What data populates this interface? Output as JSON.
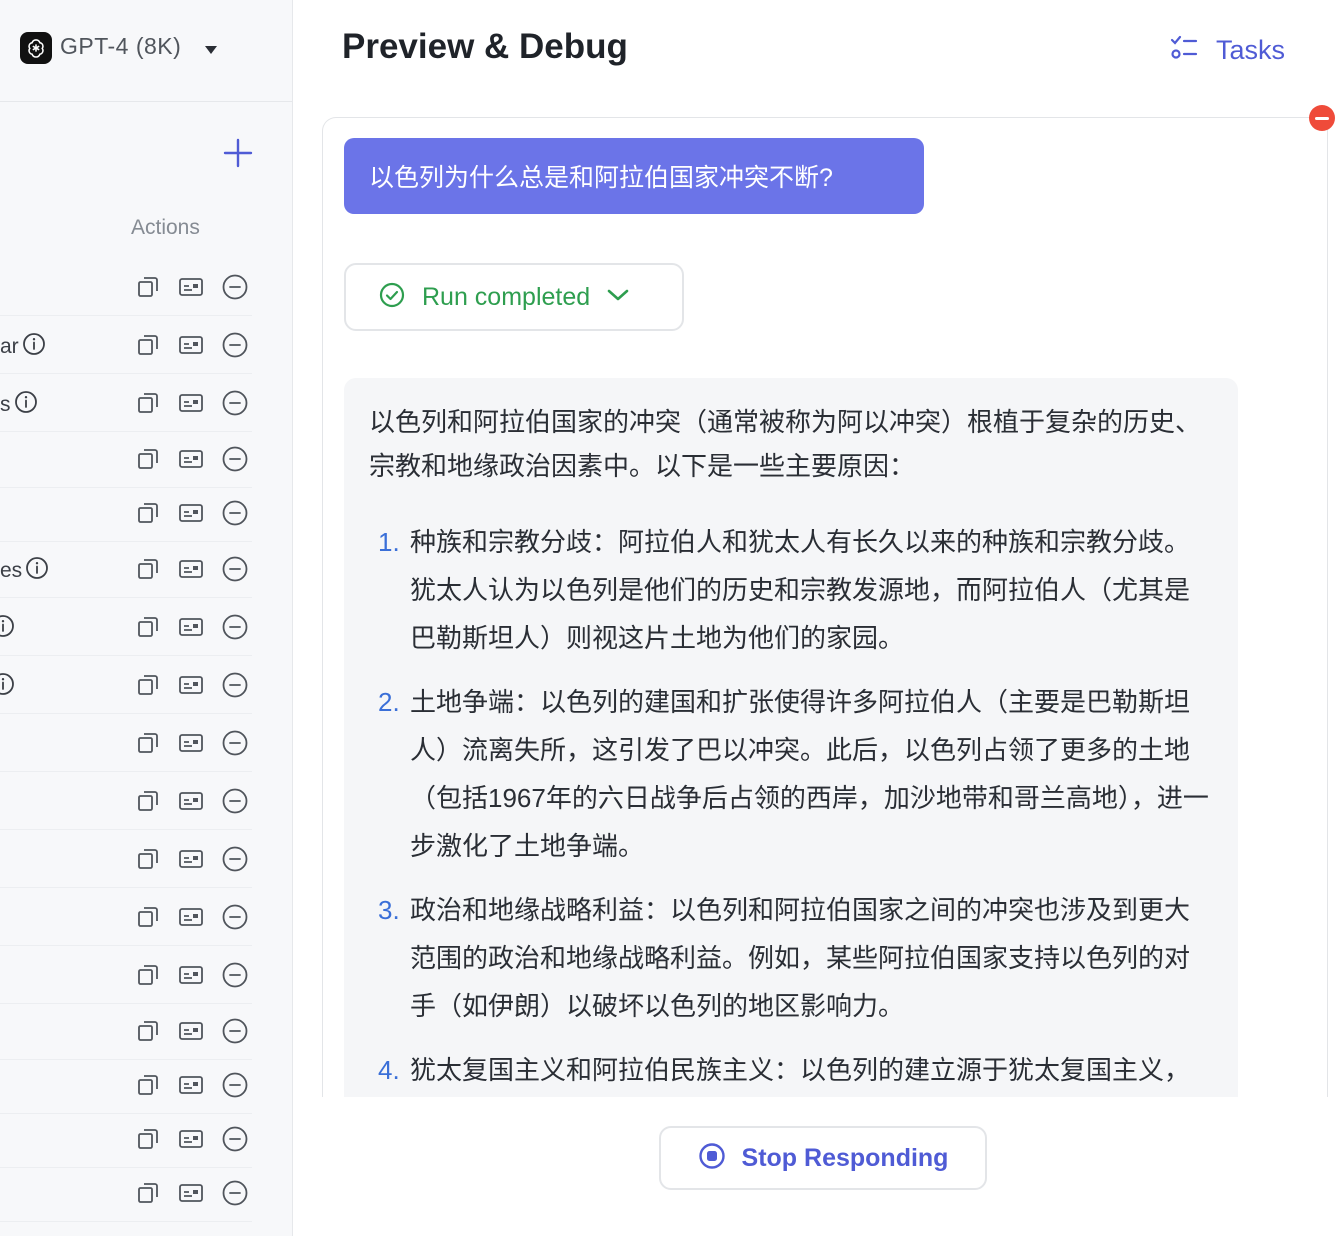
{
  "model": {
    "name": "GPT-4 (8K)",
    "icon": "openai-logo-icon"
  },
  "left_panel": {
    "add_icon": "plus-icon",
    "actions_header": "Actions",
    "rows": [
      {
        "label": "",
        "info": false
      },
      {
        "label": "ar",
        "info": true
      },
      {
        "label": "s",
        "info": true
      },
      {
        "label": "",
        "info": false
      },
      {
        "label": "",
        "info": false
      },
      {
        "label": "es",
        "info": true
      },
      {
        "label": "",
        "info": true
      },
      {
        "label": "",
        "info": true
      },
      {
        "label": "",
        "info": false
      },
      {
        "label": "",
        "info": false
      },
      {
        "label": "",
        "info": false
      },
      {
        "label": "",
        "info": false
      },
      {
        "label": "",
        "info": false
      },
      {
        "label": "",
        "info": false
      },
      {
        "label": "",
        "info": false
      },
      {
        "label": "",
        "info": false
      },
      {
        "label": "",
        "info": false
      }
    ]
  },
  "header": {
    "title": "Preview & Debug",
    "tasks_label": "Tasks"
  },
  "chat": {
    "user_message": "以色列为什么总是和阿拉伯国家冲突不断?",
    "run_status": "Run completed",
    "answer_intro": "以色列和阿拉伯国家的冲突（通常被称为阿以冲突）根植于复杂的历史、宗教和地缘政治因素中。以下是一些主要原因：",
    "answer_items": [
      {
        "num": "1.",
        "text": "种族和宗教分歧：阿拉伯人和犹太人有长久以来的种族和宗教分歧。犹太人认为以色列是他们的历史和宗教发源地，而阿拉伯人（尤其是巴勒斯坦人）则视这片土地为他们的家园。"
      },
      {
        "num": "2.",
        "text": "土地争端：以色列的建国和扩张使得许多阿拉伯人（主要是巴勒斯坦人）流离失所，这引发了巴以冲突。此后，以色列占领了更多的土地（包括1967年的六日战争后占领的西岸，加沙地带和哥兰高地），进一步激化了土地争端。"
      },
      {
        "num": "3.",
        "text": "政治和地缘战略利益：以色列和阿拉伯国家之间的冲突也涉及到更大范围的政治和地缘战略利益。例如，某些阿拉伯国家支持以色列的对手（如伊朗）以破坏以色列的地区影响力。"
      },
      {
        "num": "4.",
        "text": "犹太复国主义和阿拉伯民族主义：以色列的建立源于犹太复国主义，而阿拉伯民族主义则反对以色列在该地区的存在。"
      }
    ],
    "stop_label": "Stop Responding"
  },
  "colors": {
    "accent": "#4f5bd5",
    "user_bubble": "#6b74e8",
    "success": "#2e9e4f",
    "danger": "#ef4b3a",
    "list_number": "#3a6fd8"
  }
}
